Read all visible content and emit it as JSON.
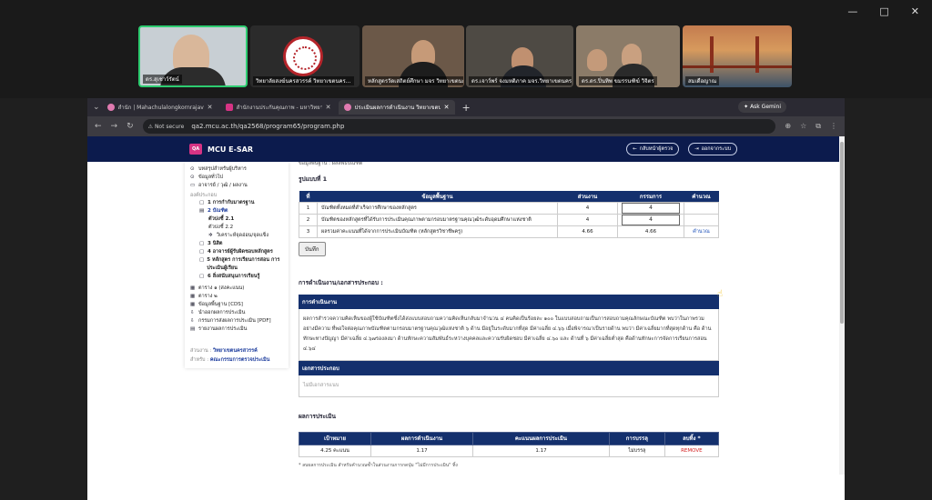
{
  "meeting": {
    "participants": [
      {
        "name": "ดร.สุเชาว์รัตน์"
      },
      {
        "name": "วิทยาลัยสงฆ์นครสวรรค์ วิทยาเขตนคร..."
      },
      {
        "name": "หลักสูตรวัดเสถิตย์ศึกษา มจร วิทยาเขตนคร..."
      },
      {
        "name": "ดร.เจาว์พร์ จงมหดิภาค มจร.วิทยาเขตนคร..."
      },
      {
        "name": "ดร.ดร.ปิ่นทิพ ขมรรนฑิฆ์ วิจิตร"
      },
      {
        "name": "สมเดือญาณ"
      }
    ],
    "window_controls": [
      "—",
      "□",
      "✕"
    ]
  },
  "browser": {
    "tabs": [
      {
        "label": "สำนัก | Mahachulalongkornrajavi...",
        "active": false
      },
      {
        "label": "สำนักงานประกันคุณภาพ - มหาวิทยาลั...",
        "active": false
      },
      {
        "label": "ประเมินผลการดำเนินงาน วิทยาเขตนคร...",
        "active": true
      }
    ],
    "new_tab": "+",
    "gemini": "Ask Gemini",
    "not_secure": "Not secure",
    "url": "qa2.mcu.ac.th/qa2568/program65/program.php"
  },
  "app": {
    "logo": "QA",
    "title": "MCU E-SAR",
    "back_button": "กลับหน้าผู้ตรวจ",
    "logout_button": "ออกจากระบบ"
  },
  "sidebar": {
    "items": [
      {
        "icon": "⊙",
        "label": "บทสรุปสำหรับผู้บริหาร"
      },
      {
        "icon": "⊙",
        "label": "ข้อมูลทั่วไป"
      },
      {
        "icon": "▭",
        "label": "อาจารย์ / วุฒิ / ผลงาน"
      }
    ],
    "head": "องค์ประกอบ",
    "components": [
      {
        "label": "1 การกำกับมาตรฐาน",
        "bold": true
      },
      {
        "label": "2 บัณฑิต",
        "active": true
      },
      {
        "label": "ตัวบ่งชี้ 2.1",
        "sub": true,
        "bold": true
      },
      {
        "label": "ตัวบ่งชี้ 2.2",
        "sub": true
      },
      {
        "label": "วิเคราะห์จุดอ่อน/จุดแข็ง",
        "sub": true
      },
      {
        "label": "3 นิสิต",
        "bold": true
      },
      {
        "label": "4 อาจารย์ผู้รับผิดชอบหลักสูตร",
        "bold": true
      },
      {
        "label": "5 หลักสูตร การเรียนการสอน การประเมินผู้เรียน",
        "bold": true
      },
      {
        "label": "6 สิ่งสนับสนุนการเรียนรู้",
        "bold": true
      }
    ],
    "reports": [
      {
        "icon": "▦",
        "label": "ตาราง ๑ (สงคะแนน)"
      },
      {
        "icon": "▦",
        "label": "ตาราง ๒"
      },
      {
        "icon": "▦",
        "label": "ข้อมูลพื้นฐาน [CDS]"
      },
      {
        "icon": "⇩",
        "label": "นำออกผลการประเมิน"
      },
      {
        "icon": "⇩",
        "label": "กรรมการส่งผลการประเมิน [PDF]"
      },
      {
        "icon": "▤",
        "label": "รายงานผลการประเมิน"
      }
    ],
    "note_unit_label": "ส่วนงาน :",
    "note_unit_value": "วิทยาเขตนครสวรรค์",
    "note_for_label": "สำหรับ :",
    "note_for_value": "คณะกรรมการตรวจประเมิน"
  },
  "main": {
    "top_cut": "ข้อมูลพื้นฐาน : ผลลัพธ์บัณฑิต",
    "format_title": "รูปแบบที่ 1",
    "table_headers": {
      "no": "ที่",
      "info": "ข้อมูลพื้นฐาน",
      "unit": "ส่วนงาน",
      "committee": "กรรมการ",
      "calc": "คำนวณ"
    },
    "rows": [
      {
        "no": "1",
        "info": "บัณฑิตทั้งหมดที่สำเร็จการศึกษาของหลักสูตร",
        "unit": "4",
        "committee": "4",
        "input": true,
        "calc": ""
      },
      {
        "no": "2",
        "info": "บัณฑิตของหลักสูตรที่ได้รับการประเมินคุณภาพตามกรอบมาตรฐานคุณวุฒิระดับอุดมศึกษาแห่งชาติ",
        "unit": "4",
        "committee": "4",
        "input": true,
        "calc": ""
      },
      {
        "no": "3",
        "info": "ผลรวมค่าคะแนนที่ได้จากการประเมินบัณฑิต (หลักสูตรวิชาชีพครู)",
        "unit": "4.66",
        "committee": "4.66",
        "input": false,
        "calc": "คำนวณ"
      }
    ],
    "save": "บันทึก",
    "ops_title": "การดำเนินงาน/เอกสารประกอบ :",
    "ops_head": "การดำเนินงาน",
    "ops_text": "ผลการสำรวจความคิดเห็นของผู้ใช้บัณฑิตซึ่งได้ส่งแบบสอบถามความคิดเห็นกลับมาจำนวน ๔ คนคิดเป็นร้อยละ ๑๐๐ ในแบบสอบถามเป็นการสอบถามคุณลักษณะบัณฑิต พบว่าในภาพรวมอย่างมีความ ที่พอใจต่อคุณภาพบัณฑิตตามกรอบมาตรฐานคุณวุฒิแห่งชาติ ๖ ด้าน มีอยู่ในระดับมากที่สุด มีค่าเฉลี่ย ๔.๖๖ เมื่อพิจารณาเป็นรายด้าน พบว่า มีค่าเฉลี่ยมากที่สุดทุกด้าน คือ ด้านทักษะทางปัญญา มีค่าเฉลี่ย ๔.๖๗รองลงมา ด้านทักษะความสัมพันธ์ระหว่างบุคคลและความรับผิดชอบ มีค่าเฉลี่ย ๔.๖๐ และ ด้านที่ ๖ มีค่าเฉลี่ยต่ำสุด คือด้านทักษะการจัดการเรียนการสอน ๔.๖๔",
    "doc_head": "เอกสารประกอบ",
    "doc_text": "ไม่มีเอกสารแนบ",
    "result_title": "ผลการประเมิน",
    "result_headers": {
      "target": "เป้าหมาย",
      "perf": "ผลการดำเนินงาน",
      "score": "คะแนนผลการประเมิน",
      "achieve": "การบรรลุ",
      "delete": "ลบทิ้ง *"
    },
    "result_row": {
      "target": "4.25 คะแนน",
      "perf": "1.17",
      "score": "1.17",
      "achieve": "ไม่บรรลุ",
      "delete": "REMOVE"
    },
    "footnote": "* ลบผลการประเมิน สำหรับคำนวณซ้ำในส่วนงานการกดปุ่ม \"ไม่มีการประเมิน\" ทิ้ง"
  },
  "colors": {
    "navy": "#14306d",
    "appbar": "#0c1b4d",
    "accent": "#d63384",
    "remove": "#d32020"
  }
}
